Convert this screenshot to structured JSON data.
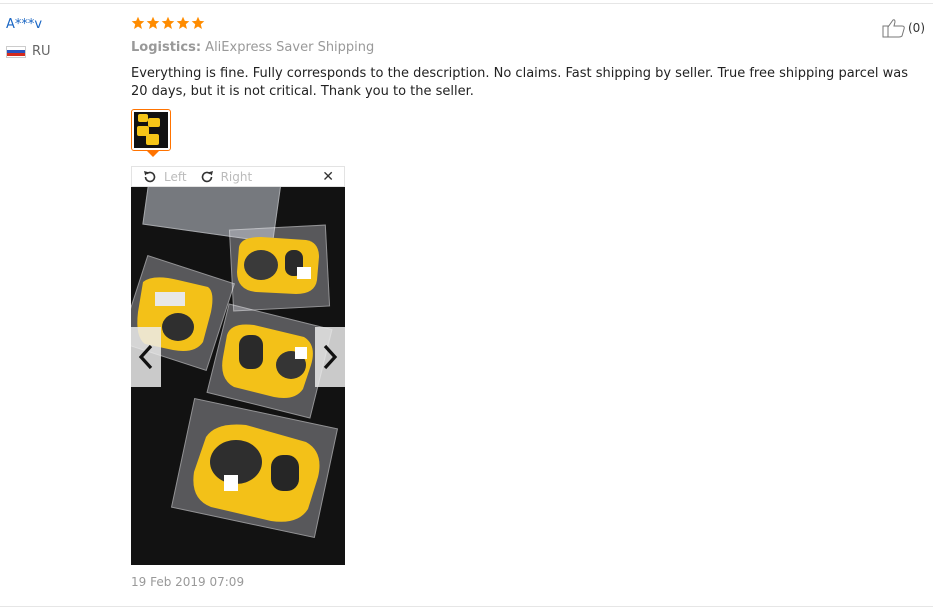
{
  "reviewer": {
    "name": "A***v",
    "country": "RU"
  },
  "rating": {
    "stars": 5,
    "max": 5,
    "color": "#ff8c00"
  },
  "logistics": {
    "label": "Logistics:",
    "value": "AliExpress Saver Shipping"
  },
  "review_text": "Everything is fine. Fully corresponds to the description. No claims. Fast shipping by seller. True free shipping parcel was 20 days, but it is not critical. Thank you to the seller.",
  "viewer": {
    "rotate_left": "Left",
    "rotate_right": "Right",
    "close_icon": "close-icon",
    "prev_icon": "chevron-left-icon",
    "next_icon": "chevron-right-icon"
  },
  "date": "19 Feb 2019 07:09",
  "helpful": {
    "count": "(0)",
    "icon": "thumbs-up-icon"
  },
  "colors": {
    "link": "#1a66c4",
    "accent": "#ff7300",
    "muted": "#999999"
  }
}
